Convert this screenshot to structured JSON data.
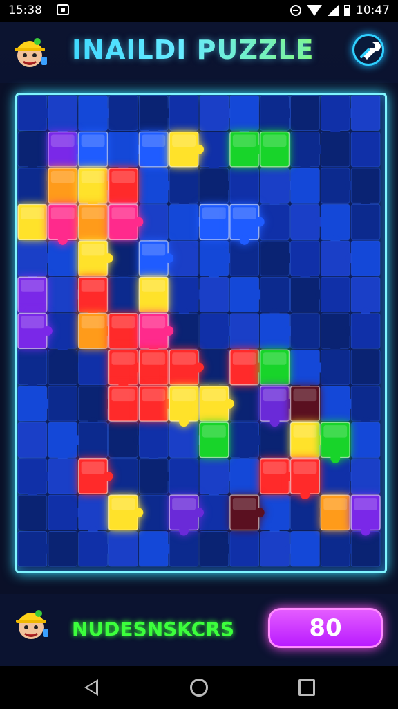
{
  "status_bar": {
    "time_left": "15:38",
    "time_right": "10:47"
  },
  "header": {
    "title": "INAILDI PUZZLE",
    "tool_icon": "wrench-icon"
  },
  "footer": {
    "player_name": "NUDESNSKCRS",
    "score": "80"
  },
  "nav": {
    "back_icon": "back-triangle-icon",
    "home_icon": "home-circle-icon",
    "recent_icon": "recent-square-icon"
  },
  "board": {
    "cols": 12,
    "rows": 13,
    "base_colors": [
      "#1030a8",
      "#0c2a8e",
      "#1a3fc7",
      "#0a2373",
      "#1448d8"
    ],
    "glow_colors": {
      "purple": "#7a28e8",
      "blue": "#1f5cff",
      "yellow": "#ffe22a",
      "orange": "#ff9b1a",
      "red": "#ff2a2a",
      "magenta": "#ff2a8c",
      "green": "#18d42a",
      "darkred": "#5a1020",
      "violet": "#6a2ad8"
    },
    "placed": [
      {
        "c": 1,
        "r": 1,
        "color": "purple"
      },
      {
        "c": 2,
        "r": 1,
        "color": "blue"
      },
      {
        "c": 4,
        "r": 1,
        "color": "blue"
      },
      {
        "c": 5,
        "r": 1,
        "color": "yellow"
      },
      {
        "c": 7,
        "r": 1,
        "color": "green"
      },
      {
        "c": 8,
        "r": 1,
        "color": "green"
      },
      {
        "c": 1,
        "r": 2,
        "color": "orange"
      },
      {
        "c": 2,
        "r": 2,
        "color": "yellow"
      },
      {
        "c": 3,
        "r": 2,
        "color": "red"
      },
      {
        "c": 0,
        "r": 3,
        "color": "yellow"
      },
      {
        "c": 1,
        "r": 3,
        "color": "magenta"
      },
      {
        "c": 2,
        "r": 3,
        "color": "orange"
      },
      {
        "c": 3,
        "r": 3,
        "color": "magenta"
      },
      {
        "c": 6,
        "r": 3,
        "color": "blue"
      },
      {
        "c": 7,
        "r": 3,
        "color": "blue"
      },
      {
        "c": 2,
        "r": 4,
        "color": "yellow"
      },
      {
        "c": 4,
        "r": 4,
        "color": "blue"
      },
      {
        "c": 2,
        "r": 5,
        "color": "red"
      },
      {
        "c": 4,
        "r": 5,
        "color": "yellow"
      },
      {
        "c": 2,
        "r": 6,
        "color": "orange"
      },
      {
        "c": 3,
        "r": 6,
        "color": "red"
      },
      {
        "c": 4,
        "r": 6,
        "color": "magenta"
      },
      {
        "c": 3,
        "r": 7,
        "color": "red"
      },
      {
        "c": 4,
        "r": 7,
        "color": "red"
      },
      {
        "c": 5,
        "r": 7,
        "color": "red"
      },
      {
        "c": 7,
        "r": 7,
        "color": "red"
      },
      {
        "c": 8,
        "r": 7,
        "color": "green"
      },
      {
        "c": 3,
        "r": 8,
        "color": "red"
      },
      {
        "c": 4,
        "r": 8,
        "color": "red"
      },
      {
        "c": 5,
        "r": 8,
        "color": "yellow"
      },
      {
        "c": 6,
        "r": 8,
        "color": "yellow"
      },
      {
        "c": 8,
        "r": 8,
        "color": "violet"
      },
      {
        "c": 9,
        "r": 8,
        "color": "darkred"
      },
      {
        "c": 6,
        "r": 9,
        "color": "green"
      },
      {
        "c": 9,
        "r": 9,
        "color": "yellow"
      },
      {
        "c": 10,
        "r": 9,
        "color": "green"
      },
      {
        "c": 2,
        "r": 10,
        "color": "red"
      },
      {
        "c": 8,
        "r": 10,
        "color": "red"
      },
      {
        "c": 9,
        "r": 10,
        "color": "red"
      },
      {
        "c": 3,
        "r": 11,
        "color": "yellow"
      },
      {
        "c": 5,
        "r": 11,
        "color": "violet"
      },
      {
        "c": 7,
        "r": 11,
        "color": "darkred"
      },
      {
        "c": 10,
        "r": 11,
        "color": "orange"
      },
      {
        "c": 11,
        "r": 11,
        "color": "purple"
      },
      {
        "c": 0,
        "r": 5,
        "color": "purple"
      },
      {
        "c": 0,
        "r": 6,
        "color": "purple"
      }
    ]
  }
}
